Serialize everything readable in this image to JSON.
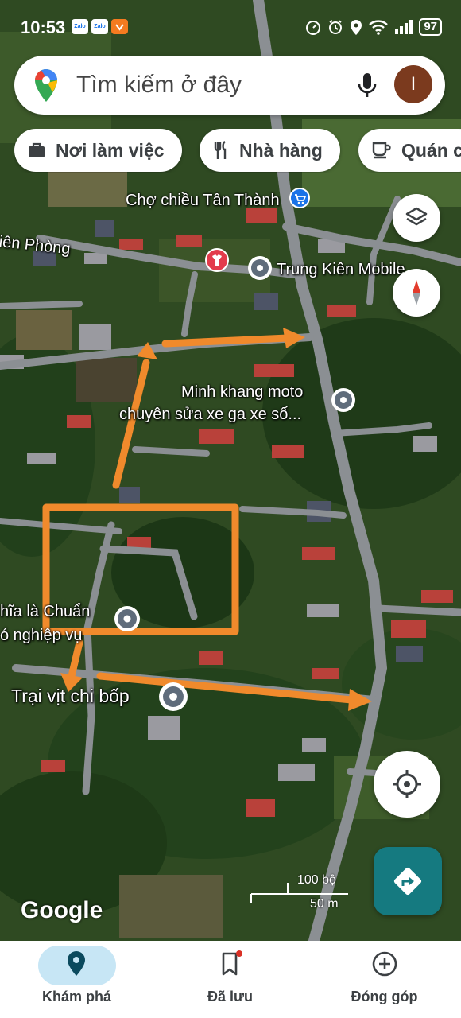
{
  "status_bar": {
    "time": "10:53",
    "app_badges": [
      "Zalo",
      "Zalo"
    ],
    "battery": "97"
  },
  "search": {
    "placeholder": "Tìm kiếm ở đây",
    "avatar_initial": "I"
  },
  "chips": [
    {
      "label": "Nơi làm việc",
      "icon": "briefcase-icon"
    },
    {
      "label": "Nhà hàng",
      "icon": "restaurant-icon"
    },
    {
      "label": "Quán c",
      "icon": "coffee-icon"
    }
  ],
  "map": {
    "labels": {
      "market": "Chợ chiều Tân Thành",
      "road_left": "iên Phòng",
      "trung_kien": "Trung Kiên Mobile",
      "minh_khang_1": "Minh khang moto",
      "minh_khang_2": "chuyên sửa xe ga xe số...",
      "left_poi_1": "hĩa là Chuẩn",
      "left_poi_2": "ó nghiệp vụ",
      "trai_vit": "Trại vịt chi bốp"
    },
    "annotation_color": "#f08a2c"
  },
  "scale": {
    "imperial": "100 bộ",
    "metric": "50 m"
  },
  "attribution": "Google",
  "bottom_nav": {
    "items": [
      {
        "label": "Khám phá",
        "icon": "explore-pin-icon",
        "active": true
      },
      {
        "label": "Đã lưu",
        "icon": "saved-bookmark-icon",
        "active": false
      },
      {
        "label": "Đóng góp",
        "icon": "contribute-plus-icon",
        "active": false
      }
    ]
  }
}
